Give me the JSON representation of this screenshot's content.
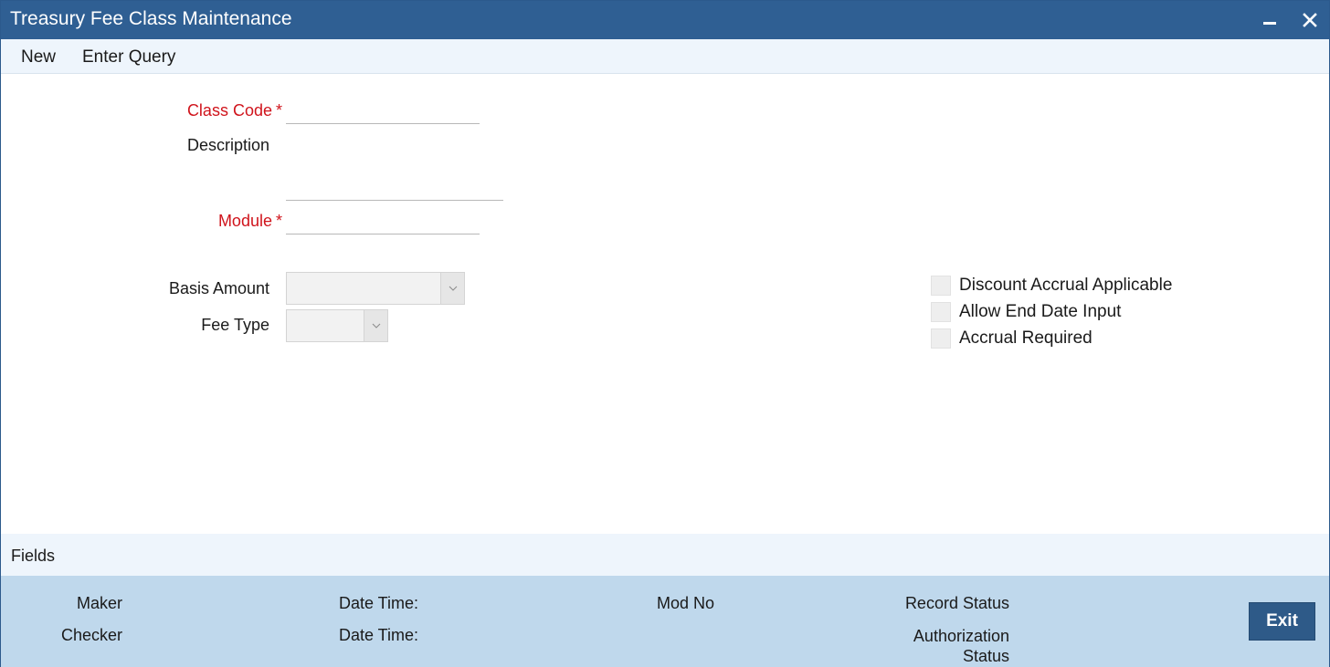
{
  "window": {
    "title": "Treasury Fee Class Maintenance"
  },
  "menu": {
    "new": "New",
    "enter_query": "Enter Query"
  },
  "form": {
    "class_code_label": "Class Code",
    "class_code_value": "",
    "description_label": "Description",
    "description_value": "",
    "module_label": "Module",
    "module_value": "",
    "basis_amount_label": "Basis Amount",
    "basis_amount_value": "",
    "fee_type_label": "Fee Type",
    "fee_type_value": "",
    "required_marker": "*"
  },
  "checkboxes": [
    {
      "label": "Discount Accrual Applicable",
      "checked": false
    },
    {
      "label": "Allow End Date Input",
      "checked": false
    },
    {
      "label": "Accrual Required",
      "checked": false
    }
  ],
  "fields_bar": {
    "label": "Fields"
  },
  "footer": {
    "maker": "Maker",
    "checker": "Checker",
    "date_time_1": "Date Time:",
    "date_time_2": "Date Time:",
    "mod_no": "Mod No",
    "record_status": "Record Status",
    "authorization_status_line1": "Authorization",
    "authorization_status_line2": "Status",
    "exit": "Exit"
  },
  "colors": {
    "titlebar": "#2f5f93",
    "required": "#d0141c",
    "footer": "#bfd8ec",
    "exit_button": "#2e5a88"
  }
}
